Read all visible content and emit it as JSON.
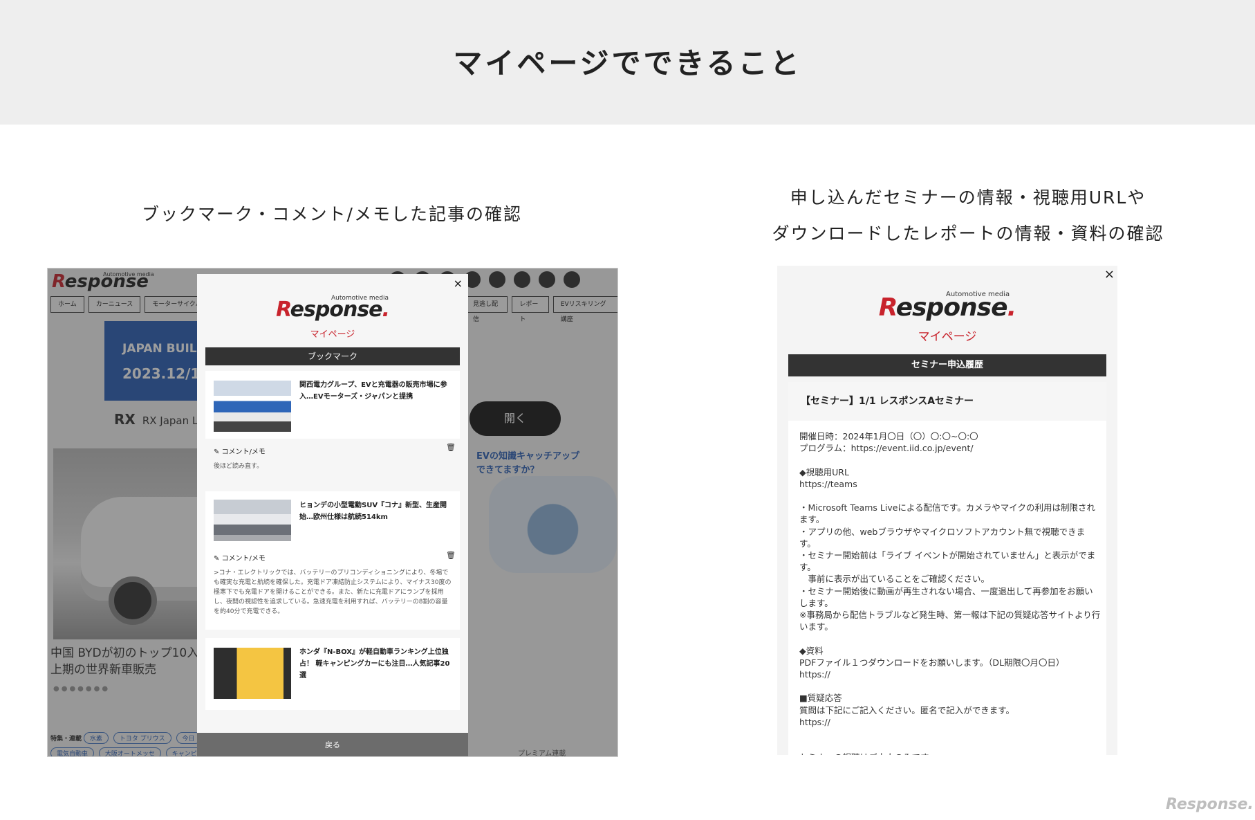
{
  "page_title": "マイページでできること",
  "captions": {
    "left": "ブックマーク・コメント/メモした記事の確認",
    "right_line1": "申し込んだセミナーの情報・視聴用URLや",
    "right_line2": "ダウンロードしたレポートの情報・資料の確認"
  },
  "left_screenshot": {
    "background_site": {
      "logo_tagline": "Automotive media",
      "logo_text": "esponse",
      "logo_r": "R",
      "nav_items": [
        "ホーム",
        "カーニュース",
        "モーターサイクルニュース"
      ],
      "nav_items_right": [
        "見逃し配信",
        "レポート",
        "EVリスキリング講座"
      ],
      "banner_line1": "JAPAN BUIL",
      "banner_line2": "2023.12/13",
      "rx_logo": "RX",
      "rx_text": "RX Japan Lt",
      "news_headline": "中国 BYDが初のトップ10入り 2023年上期の世界新車販売",
      "dots": "●●●●●●●",
      "tags_label": "特集・連載",
      "tags": [
        "水素",
        "トヨタ プリウス",
        "今日"
      ],
      "tags2": [
        "電気自動車",
        "大阪オートメッセ",
        "キャンピングカー"
      ],
      "open_button": "開く",
      "ev_text_line1": "EVの知識キャッチアップ",
      "ev_text_line2": "できてますか？",
      "premium": "プレミアム連載"
    },
    "modal": {
      "close_icon": "×",
      "logo_tagline": "Automotive media",
      "logo_r": "R",
      "logo_text": "esponse",
      "logo_dot": ".",
      "subtitle": "マイページ",
      "section_title": "ブックマーク",
      "articles": [
        {
          "title": "関西電力グループ、EVと充電器の販売市場に参入…EVモーターズ・ジャパンと提携",
          "memo_label": "✎ コメント/メモ",
          "memo_text": "後ほど読み直す。",
          "image": "bus-photo"
        },
        {
          "title": "ヒョンデの小型電動SUV『コナ』新型、生産開始…欧州仕様は航続514km",
          "memo_label": "✎ コメント/メモ",
          "memo_text": ">コナ・エレクトリックでは、バッテリーのプリコンディショニングにより、冬場でも確実な充電と航続を確保した。充電ドア凍結防止システムにより、マイナス30度の極寒下でも充電ドアを開けることができる。また、新たに充電ドアにランプを採用し、夜間の視認性を追求している。急速充電を利用すれば、バッテリーの8割の容量を約40分で充電できる。",
          "image": "suv-photo"
        },
        {
          "title": "ホンダ『N-BOX』が軽自動車ランキング上位独占！ 軽キャンピングカーにも注目…人気記事20選",
          "image": "yellow-car-photo"
        }
      ],
      "trash_icon": "🗑",
      "back_button": "戻る"
    }
  },
  "right_screenshot": {
    "close_icon": "×",
    "logo_tagline": "Automotive media",
    "logo_r": "R",
    "logo_text": "esponse",
    "logo_dot": ".",
    "subtitle": "マイページ",
    "section_title": "セミナー申込履歴",
    "seminar_title": "【セミナー】1/1 レスポンスAセミナー",
    "seminar_body": "開催日時：2024年1月〇日（〇）〇:〇~〇:〇\nプログラム：https://event.iid.co.jp/event/\n\n◆視聴用URL\nhttps://teams\n\n・Microsoft Teams Liveによる配信です。カメラやマイクの利用は制限されます。\n・アプリの他、webブラウザやマイクロソフトアカウント無で視聴できます。\n・セミナー開始前は「ライブ イベントが開始されていません」と表示がでます。\n　事前に表示が出ていることをご確認ください。\n・セミナー開始後に動画が再生されない場合、一度退出して再参加をお願いします。\n※事務局から配信トラブルなど発生時、第一報は下記の質疑応答サイトより行います。\n\n◆資料\nPDFファイル１つダウンロードをお願いします。（DL期限〇月〇日）\nhttps://\n\n■質疑応答\n質問は下記にご記入ください。匿名で記入ができます。\nhttps://\n\n\nセミナーの視聴はご本人のみです。\nURLの転送・流用はご遠慮ください。"
  },
  "footer_logo": "Response."
}
